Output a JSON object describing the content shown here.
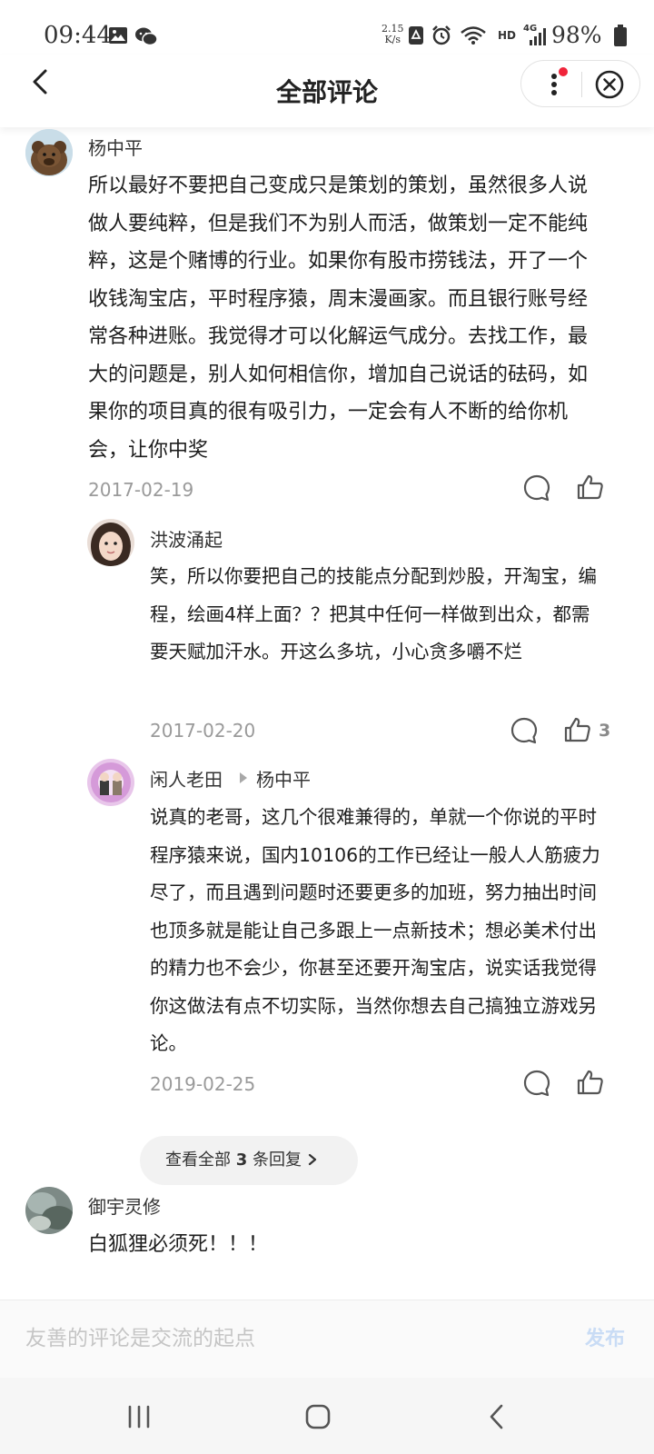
{
  "status_bar": {
    "time": "09:44",
    "speed_value": "2.15",
    "speed_unit": "K/s",
    "hd": "HD",
    "network": "4G",
    "battery": "98%"
  },
  "header": {
    "title": "全部评论"
  },
  "comments": [
    {
      "author": "杨中平",
      "text": "所以最好不要把自己变成只是策划的策划，虽然很多人说做人要纯粹，但是我们不为别人而活，做策划一定不能纯粹，这是个赌博的行业。如果你有股市捞钱法，开了一个收钱淘宝店，平时程序猿，周末漫画家。而且银行账号经常各种进账。我觉得才可以化解运气成分。去找工作，最大的问题是，别人如何相信你，增加自己说话的砝码，如果你的项目真的很有吸引力，一定会有人不断的给你机会，让你中奖",
      "date": "2017-02-19",
      "replies": [
        {
          "author": "洪波涌起",
          "text": "笑，所以你要把自己的技能点分配到炒股，开淘宝，编程，绘画4样上面？？把其中任何一样做到出众，都需要天赋加汗水。开这么多坑，小心贪多嚼不烂",
          "date": "2017-02-20",
          "likes": "3"
        },
        {
          "author": "闲人老田",
          "reply_to": "杨中平",
          "text": "说真的老哥，这几个很难兼得的，单就一个你说的平时程序猿来说，国内10106的工作已经让一般人人筋疲力尽了，而且遇到问题时还要更多的加班，努力抽出时间也顶多就是能让自己多跟上一点新技术；想必美术付出的精力也不会少，你甚至还要开淘宝店，说实话我觉得你这做法有点不切实际，当然你想去自己搞独立游戏另论。",
          "date": "2019-02-25"
        }
      ],
      "view_all": {
        "prefix": "查看全部",
        "count": "3",
        "suffix": "条回复"
      }
    },
    {
      "author": "御宇灵修",
      "text": "白狐狸必须死！！！"
    }
  ],
  "input_bar": {
    "placeholder": "友善的评论是交流的起点",
    "publish_label": "发布"
  },
  "colors": {
    "accent_dot": "#f0243a",
    "publish_disabled": "#c9dcf5",
    "meta_grey": "#9a9a9a"
  }
}
